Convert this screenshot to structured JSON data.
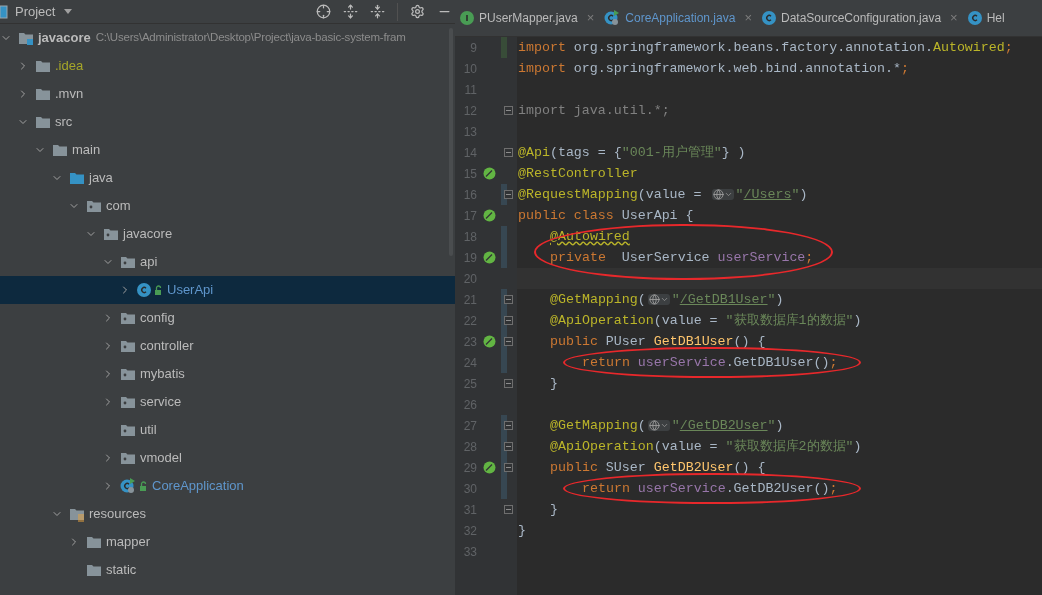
{
  "project_panel": {
    "title": "Project",
    "tree": [
      {
        "label": "javacore",
        "path": "C:\\Users\\Administrator\\Desktop\\Project\\java-basic-system-fram",
        "kind": "module",
        "color": "#bbbbbb",
        "expanded": true,
        "selected": false,
        "children": [
          {
            "label": ".idea",
            "kind": "folder",
            "color": "#a6a629",
            "expanded": false,
            "selected": false
          },
          {
            "label": ".mvn",
            "kind": "folder",
            "color": "#bbbbbb",
            "expanded": false,
            "selected": false
          },
          {
            "label": "src",
            "kind": "folder",
            "color": "#bbbbbb",
            "expanded": true,
            "selected": false,
            "children": [
              {
                "label": "main",
                "kind": "folder",
                "color": "#bbbbbb",
                "expanded": true,
                "selected": false,
                "children": [
                  {
                    "label": "java",
                    "kind": "source",
                    "color": "#bbbbbb",
                    "expanded": true,
                    "selected": false,
                    "children": [
                      {
                        "label": "com",
                        "kind": "package",
                        "color": "#bbbbbb",
                        "expanded": true,
                        "selected": false,
                        "children": [
                          {
                            "label": "javacore",
                            "kind": "package",
                            "color": "#bbbbbb",
                            "expanded": true,
                            "selected": false,
                            "children": [
                              {
                                "label": "api",
                                "kind": "package",
                                "color": "#bbbbbb",
                                "expanded": true,
                                "selected": false,
                                "children": [
                                  {
                                    "label": "UserApi",
                                    "kind": "class",
                                    "color": "#5f96cc",
                                    "expanded": false,
                                    "selected": true
                                  }
                                ]
                              },
                              {
                                "label": "config",
                                "kind": "package",
                                "color": "#bbbbbb",
                                "expanded": false,
                                "selected": false
                              },
                              {
                                "label": "controller",
                                "kind": "package",
                                "color": "#bbbbbb",
                                "expanded": false,
                                "selected": false
                              },
                              {
                                "label": "mybatis",
                                "kind": "package",
                                "color": "#bbbbbb",
                                "expanded": false,
                                "selected": false
                              },
                              {
                                "label": "service",
                                "kind": "package",
                                "color": "#bbbbbb",
                                "expanded": false,
                                "selected": false
                              },
                              {
                                "label": "util",
                                "kind": "package",
                                "color": "#bbbbbb",
                                "selected": false
                              },
                              {
                                "label": "vmodel",
                                "kind": "package",
                                "color": "#bbbbbb",
                                "expanded": false,
                                "selected": false
                              },
                              {
                                "label": "CoreApplication",
                                "kind": "application",
                                "color": "#5f96cc",
                                "expanded": false,
                                "selected": false
                              }
                            ]
                          }
                        ]
                      }
                    ]
                  },
                  {
                    "label": "resources",
                    "kind": "resources",
                    "color": "#bbbbbb",
                    "expanded": true,
                    "selected": false,
                    "children": [
                      {
                        "label": "mapper",
                        "kind": "folder",
                        "color": "#bbbbbb",
                        "expanded": false,
                        "selected": false
                      },
                      {
                        "label": "static",
                        "kind": "folder",
                        "color": "#bbbbbb",
                        "selected": false
                      }
                    ]
                  }
                ]
              }
            ]
          }
        ]
      }
    ]
  },
  "editor": {
    "tabs": [
      {
        "label": "PUserMapper.java",
        "close": "×",
        "kind": "interface",
        "color": "#bbbbbb",
        "selected": false
      },
      {
        "label": "CoreApplication.java",
        "close": "×",
        "kind": "application",
        "color": "#5f96cc",
        "selected": false
      },
      {
        "label": "DataSourceConfiguration.java",
        "close": "×",
        "kind": "class",
        "color": "#bbbbbb",
        "selected": false
      },
      {
        "label": "Hel",
        "kind": "class",
        "color": "#bbbbbb",
        "selected": false
      }
    ],
    "lines": [
      {
        "number": "9",
        "color": "#384c38",
        "kind": "top",
        "tokens": [
          {
            "kind": "keyword",
            "text": "import"
          },
          {
            "kind": "plain",
            "text": " org.springframework.beans.factory.annotation."
          },
          {
            "kind": "annotation",
            "text": "Autowired"
          },
          {
            "kind": "keyword",
            "text": ";"
          }
        ]
      },
      {
        "number": "10",
        "kind": "top",
        "tokens": [
          {
            "kind": "keyword",
            "text": "import"
          },
          {
            "kind": "plain",
            "text": " org.springframework.web.bind.annotation.*"
          },
          {
            "kind": "keyword",
            "text": ";"
          }
        ]
      },
      {
        "number": "11",
        "kind": "top"
      },
      {
        "number": "12",
        "kind": "top",
        "fold": true,
        "tokens": [
          {
            "kind": "unused",
            "text": "import java.util.*;"
          }
        ]
      },
      {
        "number": "13",
        "kind": "top"
      },
      {
        "number": "14",
        "kind": "top",
        "fold": true,
        "tokens": [
          {
            "kind": "annotation",
            "text": "@Api"
          },
          {
            "kind": "plain",
            "text": "(tags = {"
          },
          {
            "kind": "string",
            "text": "\"001-用户管理\""
          },
          {
            "kind": "plain",
            "text": "} )"
          }
        ]
      },
      {
        "number": "15",
        "kind": "top",
        "bean": true,
        "tokens": [
          {
            "kind": "annotation",
            "text": "@RestController"
          }
        ]
      },
      {
        "number": "16",
        "kind": "top",
        "fold": true,
        "color": "#374752",
        "tokens": [
          {
            "kind": "annotation",
            "text": "@RequestMapping"
          },
          {
            "kind": "plain",
            "text": "(value = "
          },
          {
            "kind": "globe"
          },
          {
            "kind": "string",
            "text": "\""
          },
          {
            "kind": "url",
            "text": "/Users"
          },
          {
            "kind": "string",
            "text": "\""
          },
          {
            "kind": "plain",
            "text": ")"
          }
        ]
      },
      {
        "number": "17",
        "kind": "top",
        "bean": true,
        "tokens": [
          {
            "kind": "keyword",
            "text": "public class "
          },
          {
            "kind": "plain",
            "text": "UserApi {"
          }
        ]
      },
      {
        "number": "18",
        "kind": "member",
        "color": "#374752",
        "circled": true,
        "tokens": [
          {
            "kind": "warning",
            "text": "@Autowired"
          }
        ]
      },
      {
        "number": "19",
        "kind": "member",
        "bean": true,
        "color": "#374752",
        "circled": true,
        "tokens": [
          {
            "kind": "keyword",
            "text": "private"
          },
          {
            "kind": "plain",
            "text": "  UserService "
          },
          {
            "kind": "field",
            "text": "userService"
          },
          {
            "kind": "keyword",
            "text": ";"
          }
        ]
      },
      {
        "number": "20",
        "kind": "top",
        "current": true
      },
      {
        "number": "21",
        "kind": "member",
        "fold": true,
        "color": "#374752",
        "tokens": [
          {
            "kind": "annotation",
            "text": "@GetMapping"
          },
          {
            "kind": "plain",
            "text": "("
          },
          {
            "kind": "globe"
          },
          {
            "kind": "string",
            "text": "\""
          },
          {
            "kind": "url",
            "text": "/GetDB1User"
          },
          {
            "kind": "string",
            "text": "\""
          },
          {
            "kind": "plain",
            "text": ")"
          }
        ]
      },
      {
        "number": "22",
        "kind": "member",
        "fold": true,
        "color": "#374752",
        "tokens": [
          {
            "kind": "annotation",
            "text": "@ApiOperation"
          },
          {
            "kind": "plain",
            "text": "(value = "
          },
          {
            "kind": "string",
            "text": "\"获取数据库1的数据\""
          },
          {
            "kind": "plain",
            "text": ")"
          }
        ]
      },
      {
        "number": "23",
        "kind": "member",
        "bean": true,
        "fold": true,
        "color": "#374752",
        "tokens": [
          {
            "kind": "keyword",
            "text": "public "
          },
          {
            "kind": "plain",
            "text": "PUser "
          },
          {
            "kind": "method",
            "text": "GetDB1User"
          },
          {
            "kind": "plain",
            "text": "() {"
          }
        ]
      },
      {
        "number": "24",
        "kind": "body",
        "color": "#374752",
        "circled": true,
        "tokens": [
          {
            "kind": "keyword",
            "text": "return "
          },
          {
            "kind": "field",
            "text": "userService"
          },
          {
            "kind": "plain",
            "text": ".GetDB1User()"
          },
          {
            "kind": "keyword",
            "text": ";"
          }
        ]
      },
      {
        "number": "25",
        "kind": "member",
        "fold": true,
        "tokens": [
          {
            "kind": "plain",
            "text": "}"
          }
        ]
      },
      {
        "number": "26",
        "kind": "top"
      },
      {
        "number": "27",
        "kind": "member",
        "fold": true,
        "color": "#374752",
        "tokens": [
          {
            "kind": "annotation",
            "text": "@GetMapping"
          },
          {
            "kind": "plain",
            "text": "("
          },
          {
            "kind": "globe"
          },
          {
            "kind": "string",
            "text": "\""
          },
          {
            "kind": "url",
            "text": "/GetDB2User"
          },
          {
            "kind": "string",
            "text": "\""
          },
          {
            "kind": "plain",
            "text": ")"
          }
        ]
      },
      {
        "number": "28",
        "kind": "member",
        "fold": true,
        "color": "#374752",
        "tokens": [
          {
            "kind": "annotation",
            "text": "@ApiOperation"
          },
          {
            "kind": "plain",
            "text": "(value = "
          },
          {
            "kind": "string",
            "text": "\"获取数据库2的数据\""
          },
          {
            "kind": "plain",
            "text": ")"
          }
        ]
      },
      {
        "number": "29",
        "kind": "member",
        "bean": true,
        "fold": true,
        "color": "#374752",
        "tokens": [
          {
            "kind": "keyword",
            "text": "public "
          },
          {
            "kind": "plain",
            "text": "SUser "
          },
          {
            "kind": "method",
            "text": "GetDB2User"
          },
          {
            "kind": "plain",
            "text": "() {"
          }
        ]
      },
      {
        "number": "30",
        "kind": "body",
        "color": "#374752",
        "circled": true,
        "tokens": [
          {
            "kind": "keyword",
            "text": "return "
          },
          {
            "kind": "field",
            "text": "userService"
          },
          {
            "kind": "plain",
            "text": ".GetDB2User()"
          },
          {
            "kind": "keyword",
            "text": ";"
          }
        ]
      },
      {
        "number": "31",
        "kind": "member",
        "fold": true,
        "tokens": [
          {
            "kind": "plain",
            "text": "}"
          }
        ]
      },
      {
        "number": "32",
        "kind": "top",
        "tokens": [
          {
            "kind": "plain",
            "text": "}"
          }
        ]
      },
      {
        "number": "33",
        "kind": "top"
      }
    ]
  }
}
